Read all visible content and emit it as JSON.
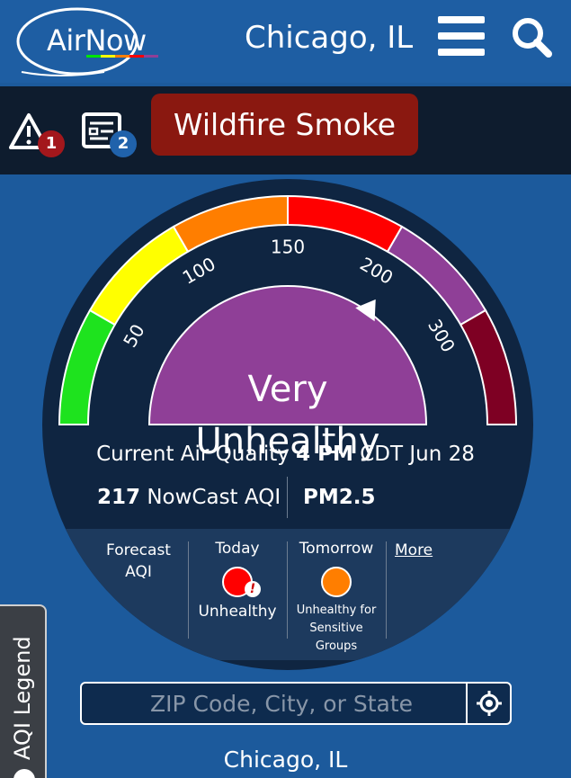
{
  "header": {
    "logo_text": "AirNow",
    "city": "Chicago, IL",
    "menu_icon": "hamburger-menu-icon",
    "search_icon": "search-icon"
  },
  "alerts": {
    "warnings_count": "1",
    "notices_count": "2",
    "smoke_label": "Wildfire Smoke"
  },
  "gauge": {
    "tick_labels": [
      "50",
      "100",
      "150",
      "200",
      "300"
    ],
    "category_line1": "Very",
    "category_line2": "Unhealthy",
    "aqi_value": 217,
    "colors": {
      "good": "#1ee31e",
      "moderate": "#ffff00",
      "usg": "#ff7e00",
      "unhealthy": "#ff0000",
      "very_unhealthy": "#8f3f97",
      "hazardous": "#7e0023"
    }
  },
  "current": {
    "prefix": "Current Air Quality",
    "time": "4 PM",
    "suffix": "CDT Jun 28",
    "aqi_number": "217",
    "aqi_label": "NowCast AQI",
    "pollutant": "PM2.5"
  },
  "forecast": {
    "label_line1": "Forecast",
    "label_line2": "AQI",
    "today": {
      "label": "Today",
      "category": "Unhealthy",
      "color": "#ff0000"
    },
    "tomorrow": {
      "label": "Tomorrow",
      "category_line1": "Unhealthy for",
      "category_line2": "Sensitive",
      "category_line3": "Groups",
      "color": "#ff7e00"
    },
    "more_label": "More"
  },
  "search": {
    "placeholder": "ZIP Code, City, or State",
    "location_icon": "crosshair-location-icon"
  },
  "location_name": "Chicago, IL",
  "legend_tab": "AQI Legend"
}
